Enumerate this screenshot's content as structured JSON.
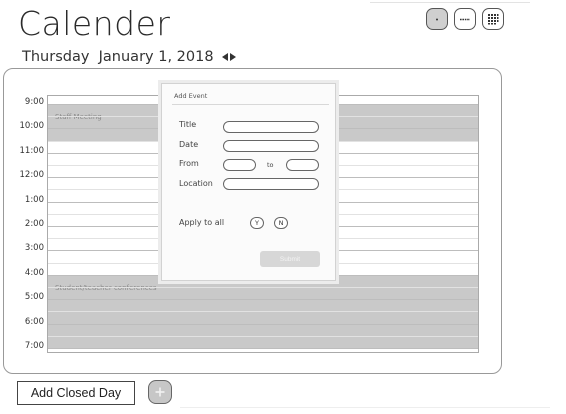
{
  "header": {
    "title": "Calender",
    "views": [
      {
        "icon": "dot-icon",
        "active": true
      },
      {
        "icon": "dash-icon",
        "active": false
      },
      {
        "icon": "grid-icon",
        "active": false
      }
    ]
  },
  "date_bar": {
    "date_text": "Thursday  January 1, 2018",
    "nav_icon": "prev-next-arrows-icon"
  },
  "timeline": {
    "hours": [
      "9:00",
      "10:00",
      "11:00",
      "12:00",
      "1:00",
      "2:00",
      "3:00",
      "4:00",
      "5:00",
      "6:00",
      "7:00"
    ],
    "events": [
      {
        "label": "Staff Meeting",
        "start_index": 0,
        "end_index": 1.5
      },
      {
        "label": "Student/teacher conferences",
        "start_index": 7,
        "end_index": 10
      }
    ]
  },
  "dialog": {
    "title": "Add Event",
    "fields": {
      "title_label": "Title",
      "date_label": "Date",
      "from_label": "From",
      "to_label": "to",
      "location_label": "Location",
      "apply_label": "Apply to all"
    },
    "yes_label": "Y",
    "no_label": "N",
    "submit_label": "Submit"
  },
  "footer": {
    "closed_day_label": "Add Closed Day",
    "add_icon": "plus-icon"
  },
  "colors": {
    "event_fill": "#c9c9c9",
    "active_view": "#cfcfcf",
    "submit_fill": "#d7d7d7"
  }
}
